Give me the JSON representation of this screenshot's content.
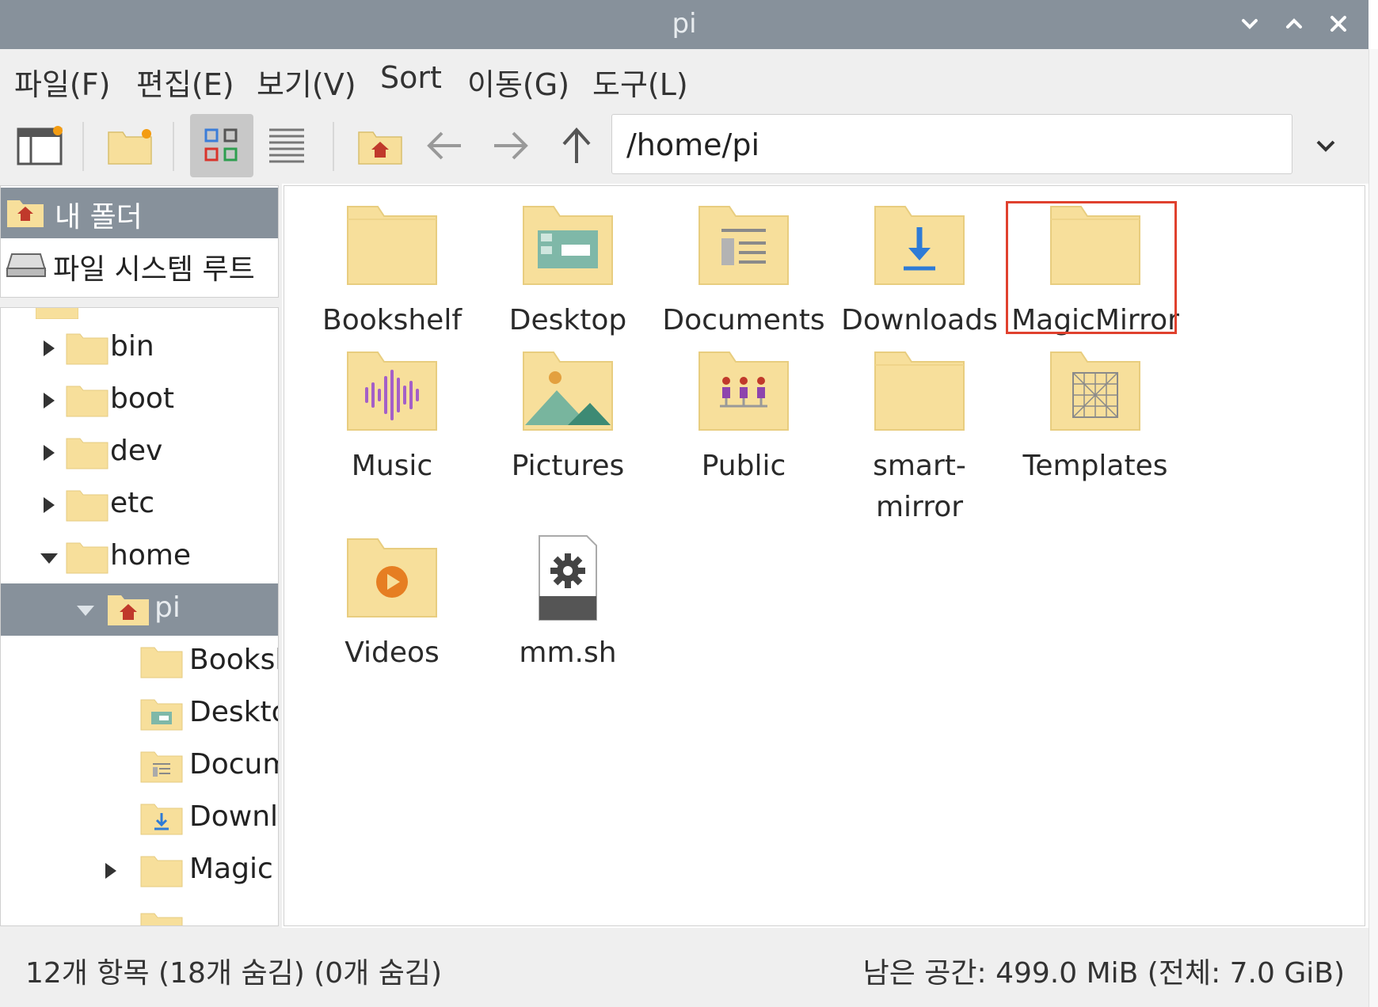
{
  "window": {
    "title": "pi"
  },
  "menu": [
    "파일(F)",
    "편집(E)",
    "보기(V)",
    "Sort",
    "이동(G)",
    "도구(L)"
  ],
  "toolbar": {
    "path": "/home/pi"
  },
  "places": [
    {
      "label": "내 폴더",
      "icon": "home-folder-icon"
    },
    {
      "label": "파일 시스템 루트",
      "icon": "drive-icon"
    }
  ],
  "tree": [
    {
      "label": "bin"
    },
    {
      "label": "boot"
    },
    {
      "label": "dev"
    },
    {
      "label": "etc"
    },
    {
      "label": "home"
    },
    {
      "label": "pi"
    },
    {
      "label": "Booksh"
    },
    {
      "label": "Deskto"
    },
    {
      "label": "Docum"
    },
    {
      "label": "Downl"
    },
    {
      "label": "Magic"
    }
  ],
  "files": [
    {
      "label": "Bookshelf",
      "icon": "folder-icon"
    },
    {
      "label": "Desktop",
      "icon": "desktop-folder-icon"
    },
    {
      "label": "Documents",
      "icon": "documents-folder-icon"
    },
    {
      "label": "Downloads",
      "icon": "downloads-folder-icon"
    },
    {
      "label": "MagicMirror",
      "icon": "folder-icon"
    },
    {
      "label": "Music",
      "icon": "music-folder-icon"
    },
    {
      "label": "Pictures",
      "icon": "pictures-folder-icon"
    },
    {
      "label": "Public",
      "icon": "public-folder-icon"
    },
    {
      "label": "smart-",
      "label2": "mirror",
      "icon": "folder-icon"
    },
    {
      "label": "Templates",
      "icon": "templates-folder-icon"
    },
    {
      "label": "Videos",
      "icon": "videos-folder-icon"
    },
    {
      "label": "mm.sh",
      "icon": "script-file-icon"
    }
  ],
  "status": {
    "left": "12개 항목 (18개 숨김) (0개 숨김)",
    "right": "남은 공간: 499.0 MiB (전체: 7.0 GiB)"
  },
  "colors": {
    "folder": "#f7df9b",
    "folder_tab": "#ecd086",
    "selection": "#87919b",
    "highlight": "#e0412e"
  }
}
